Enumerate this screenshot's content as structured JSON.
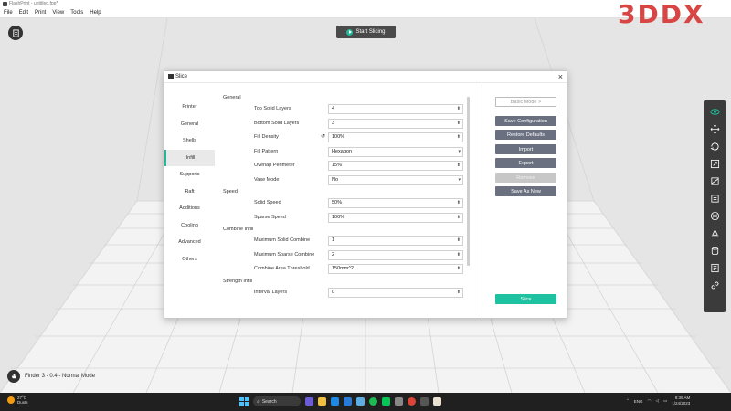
{
  "window": {
    "title": "FlashPrint - untitled.fpp*"
  },
  "menu": [
    "File",
    "Edit",
    "Print",
    "View",
    "Tools",
    "Help"
  ],
  "logo": "3DDX",
  "toolbar": {
    "start_slicing": "Start Slicing"
  },
  "status": {
    "printer_mode": "Finder 3 - 0.4 - Normal Mode"
  },
  "dialog": {
    "title": "Slice",
    "close": "×",
    "tabs": [
      "Printer",
      "General",
      "Shells",
      "Infill",
      "Supports",
      "Raft",
      "Additions",
      "Cooling",
      "Advanced",
      "Others"
    ],
    "active_tab": "Infill",
    "sections": {
      "general": "General",
      "speed": "Speed",
      "combine": "Combine Infill",
      "strength": "Strength Infill"
    },
    "fields": {
      "top_solid_layers": {
        "label": "Top Solid Layers",
        "value": "4"
      },
      "bottom_solid_layers": {
        "label": "Bottom Solid Layers",
        "value": "3"
      },
      "fill_density": {
        "label": "Fill Density",
        "value": "100%"
      },
      "fill_pattern": {
        "label": "Fill Pattern",
        "value": "Hexagon"
      },
      "overlap_perimeter": {
        "label": "Overlap Perimeter",
        "value": "15%"
      },
      "vase_mode": {
        "label": "Vase Mode",
        "value": "No"
      },
      "solid_speed": {
        "label": "Solid Speed",
        "value": "50%"
      },
      "sparse_speed": {
        "label": "Sparse Speed",
        "value": "100%"
      },
      "max_solid_combine": {
        "label": "Maximum Solid Combine",
        "value": "1"
      },
      "max_sparse_combine": {
        "label": "Maximum Sparse Combine",
        "value": "2"
      },
      "combine_area_threshold": {
        "label": "Combine Area Threshold",
        "value": "150mm^2"
      },
      "interval_layers": {
        "label": "Interval Layers",
        "value": "0"
      }
    },
    "buttons": {
      "basic_mode": "Basic Mode >",
      "save_config": "Save Configuration",
      "restore_defaults": "Restore Defaults",
      "import": "Import",
      "export": "Export",
      "remove": "Remove",
      "save_as_new": "Save As New",
      "slice": "Slice"
    }
  },
  "taskbar": {
    "temperature": "27°C",
    "weather": "Dusts",
    "search": "Search",
    "language": "ENG",
    "time": "8:39 AM",
    "date": "1/24/2023"
  },
  "colors": {
    "accent": "#1ec2a0",
    "logo": "#d84545",
    "rtoolbar": "#3b3b3b"
  }
}
